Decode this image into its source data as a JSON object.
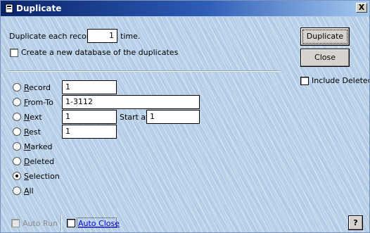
{
  "window": {
    "title": "Duplicate",
    "close_glyph": "X"
  },
  "duplicate": {
    "prefix": "Duplicate each record",
    "count": "1",
    "suffix": "time.",
    "create_db_label": "Create a new database of the duplicates"
  },
  "buttons": {
    "duplicate": "Duplicate",
    "close": "Close",
    "help": "?"
  },
  "include_deleted": "Include Deleted",
  "scope": {
    "record": {
      "label": "Record",
      "value": "1"
    },
    "from_to": {
      "label": "From-To",
      "value": "1-3112"
    },
    "next": {
      "label": "Next",
      "value": "1",
      "start_at_label": "Start at:",
      "start_at_value": "1"
    },
    "rest": {
      "label": "Rest",
      "value": "1"
    },
    "marked": {
      "label": "Marked"
    },
    "deleted": {
      "label": "Deleted"
    },
    "selection": {
      "label": "Selection",
      "selected": true
    },
    "all": {
      "label": "All"
    }
  },
  "footer": {
    "auto_run": "Auto Run",
    "auto_close": "Auto Close"
  },
  "colors": {
    "titlebar_start": "#0a246a",
    "titlebar_end": "#a6caf0",
    "link": "#0000ee"
  },
  "icons": [
    "app-icon",
    "close-icon",
    "help-icon"
  ]
}
